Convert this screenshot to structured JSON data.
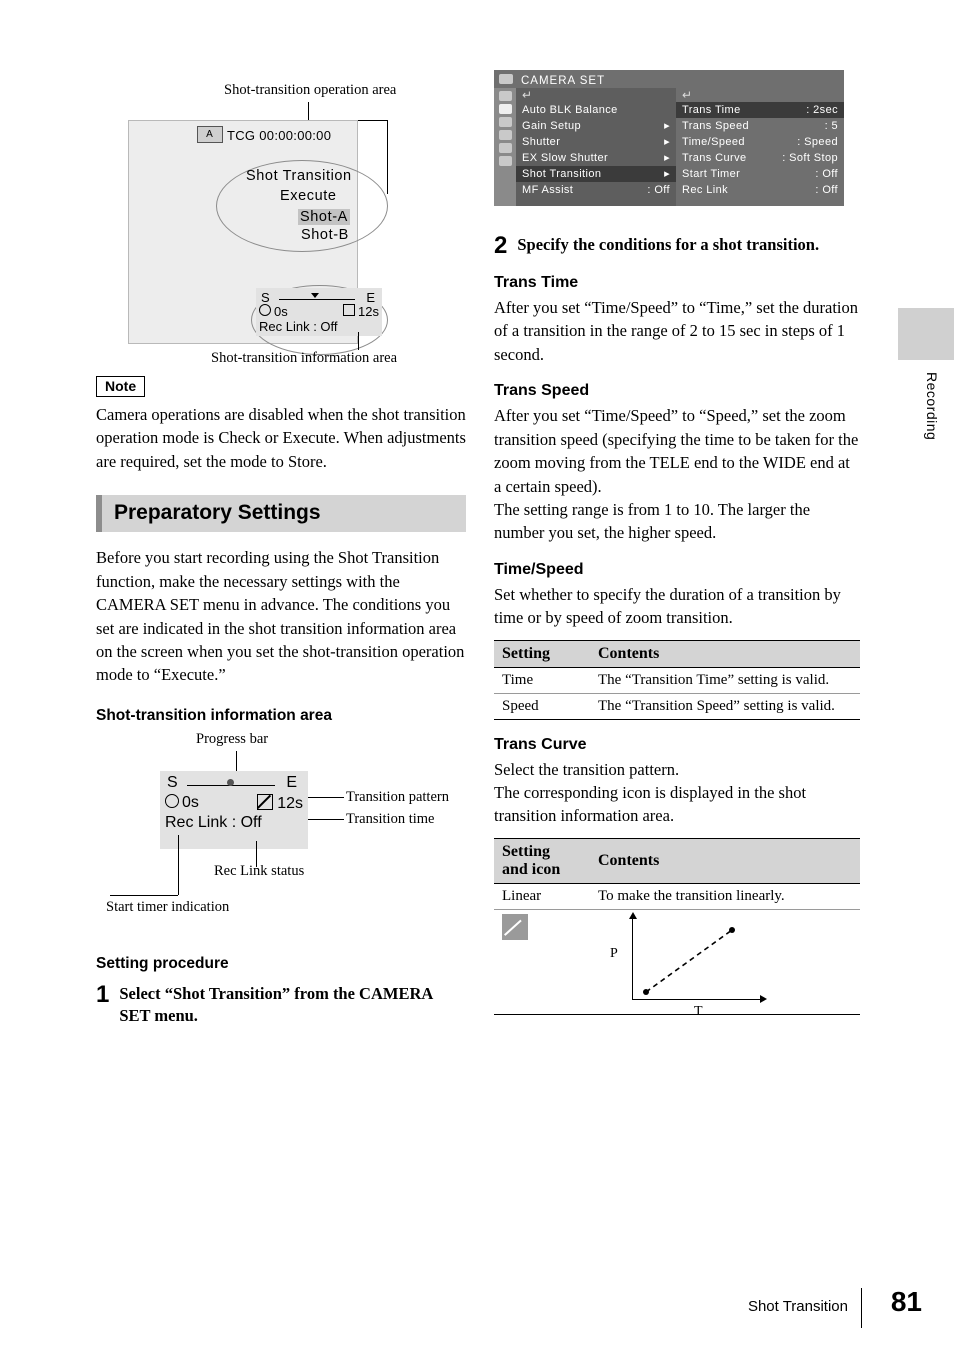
{
  "figure1": {
    "label_top": "Shot-transition operation area",
    "label_bottom": "Shot-transition information area",
    "a_icon": "A",
    "tcg": "TCG 00:00:00:00",
    "shot_transition": "Shot Transition",
    "execute": "Execute",
    "shot_a": "Shot-A",
    "shot_b": "Shot-B",
    "bar_s": "S",
    "bar_e": "E",
    "timer": "0s",
    "duration": "12s",
    "rec_link": "Rec Link : Off"
  },
  "note": {
    "badge": "Note",
    "text": "Camera operations are disabled when the shot transition operation mode is Check or Execute. When adjustments are required, set the mode to Store."
  },
  "section": {
    "title": "Preparatory Settings",
    "paragraph": "Before you start recording using the Shot Transition function, make the necessary settings with the CAMERA SET menu in advance. The conditions you set are indicated in the shot transition information area on the screen when you set the shot-transition operation mode to “Execute.”",
    "subhead_info_area": "Shot-transition information area",
    "subhead_procedure": "Setting procedure"
  },
  "figure2": {
    "label_progress": "Progress bar",
    "label_pattern": "Transition pattern",
    "label_time": "Transition time",
    "label_reclink": "Rec Link status",
    "label_starttimer": "Start timer indication",
    "bar_s": "S",
    "bar_e": "E",
    "timer": "0s",
    "duration": "12s",
    "rec_link": "Rec Link : Off"
  },
  "steps": [
    {
      "num": "1",
      "text": "Select “Shot Transition” from the CAMERA SET menu."
    },
    {
      "num": "2",
      "text": "Specify the conditions for a shot transition."
    }
  ],
  "menu": {
    "title": "CAMERA SET",
    "left_items": [
      {
        "label": "Auto BLK Balance",
        "value": ""
      },
      {
        "label": "Gain Setup",
        "value": "▸"
      },
      {
        "label": "Shutter",
        "value": "▸"
      },
      {
        "label": "EX Slow Shutter",
        "value": "▸"
      },
      {
        "label": "Shot Transition",
        "value": "▸"
      },
      {
        "label": "MF Assist",
        "value": ": Off"
      }
    ],
    "right_items": [
      {
        "label": "Trans Time",
        "value": ": 2sec"
      },
      {
        "label": "Trans Speed",
        "value": ": 5"
      },
      {
        "label": "Time/Speed",
        "value": ": Speed"
      },
      {
        "label": "Trans Curve",
        "value": ": Soft Stop"
      },
      {
        "label": "Start Timer",
        "value": ": Off"
      },
      {
        "label": "Rec Link",
        "value": ": Off"
      }
    ]
  },
  "right": {
    "trans_time_head": "Trans Time",
    "trans_time_body": "After you set “Time/Speed” to “Time,” set the duration of a transition in the range of 2 to 15 sec in steps of 1 second.",
    "trans_speed_head": "Trans Speed",
    "trans_speed_body1": "After you set “Time/Speed” to “Speed,” set the zoom transition speed (specifying the time to be taken for the zoom moving from the TELE end to the WIDE end at a certain speed).",
    "trans_speed_body2": "The setting range is from 1 to 10. The larger the number you set, the higher speed.",
    "time_speed_head": "Time/Speed",
    "time_speed_body": "Set whether to specify the duration of a transition by time or by speed of zoom transition.",
    "table1": {
      "headers": [
        "Setting",
        "Contents"
      ],
      "rows": [
        [
          "Time",
          "The “Transition Time” setting is valid."
        ],
        [
          "Speed",
          "The “Transition Speed” setting is valid."
        ]
      ]
    },
    "trans_curve_head": "Trans Curve",
    "trans_curve_body1": "Select the transition pattern.",
    "trans_curve_body2": "The corresponding icon is displayed in the shot transition information area.",
    "table2": {
      "header_setting": "Setting",
      "header_setting2": "and icon",
      "header_contents": "Contents",
      "row_label": "Linear",
      "row_contents": "To make the transition linearly.",
      "graph_y": "P",
      "graph_x": "T"
    }
  },
  "sidebar": {
    "tab_label": "Recording"
  },
  "footer": {
    "section": "Shot Transition",
    "page": "81"
  }
}
